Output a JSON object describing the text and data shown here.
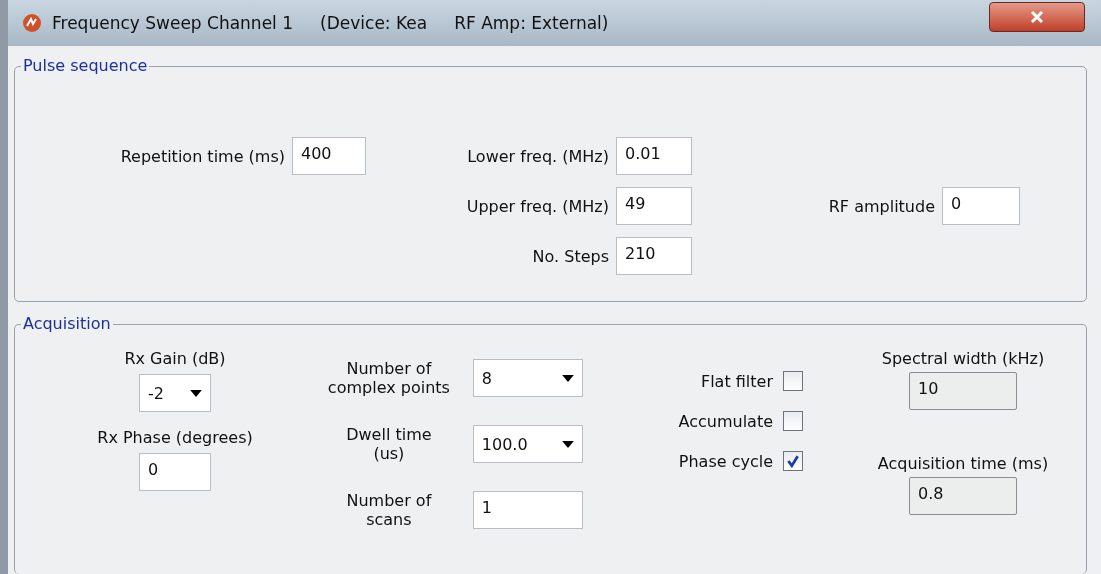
{
  "window": {
    "title": "Frequency Sweep Channel 1     (Device: Kea     RF Amp: External)"
  },
  "pulse_sequence": {
    "title": "Pulse sequence",
    "fields": [
      {
        "label": "Repetition time (ms)",
        "value": "400"
      },
      {
        "label": "Lower freq. (MHz)",
        "value": "0.01"
      },
      {
        "label": "Upper freq. (MHz)",
        "value": "49"
      },
      {
        "label": "RF amplitude",
        "value": "0"
      },
      {
        "label": "No. Steps",
        "value": "210"
      }
    ]
  },
  "acquisition": {
    "title": "Acquisition",
    "receiver": [
      {
        "kind": "dropdown",
        "label": "Rx Gain (dB)",
        "value": "-2"
      },
      {
        "kind": "text",
        "label": "Rx Phase (degrees)",
        "value": "0"
      }
    ],
    "sampling": [
      {
        "kind": "dropdown",
        "label": "Number of\ncomplex points",
        "value": "8"
      },
      {
        "kind": "dropdown",
        "label": "Dwell time\n(us)",
        "value": "100.0"
      },
      {
        "kind": "text",
        "label": "Number of\nscans",
        "value": "1"
      }
    ],
    "options": [
      {
        "label": "Flat filter",
        "checked": false
      },
      {
        "label": "Accumulate",
        "checked": false
      },
      {
        "label": "Phase cycle",
        "checked": true
      }
    ],
    "timing": [
      {
        "label": "Spectral width (kHz)",
        "value": "10",
        "readonly": true
      },
      {
        "label": "Acquisition time (ms)",
        "value": "0.8",
        "readonly": true
      }
    ]
  }
}
